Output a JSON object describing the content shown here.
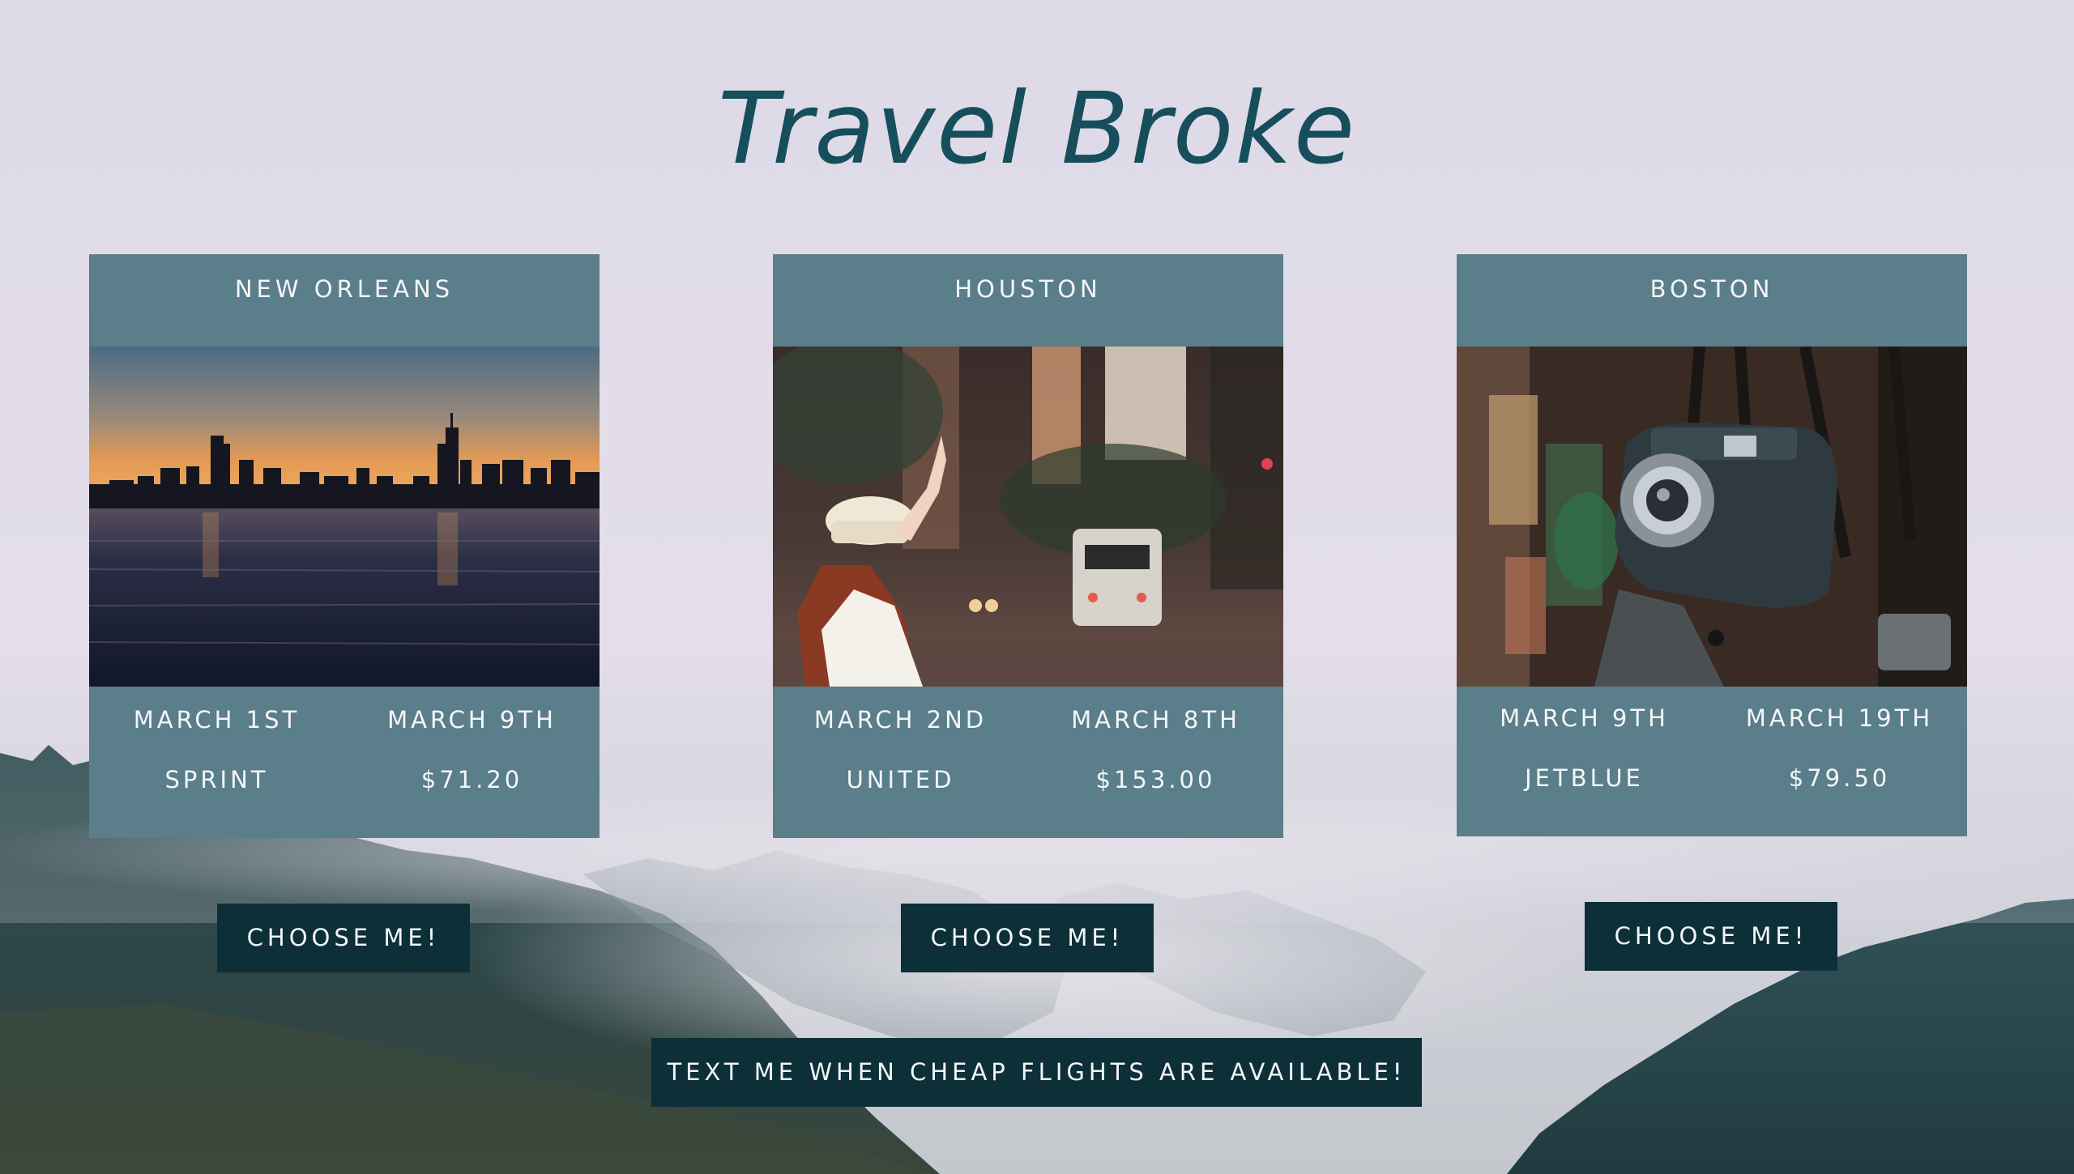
{
  "header": {
    "title": "Travel Broke"
  },
  "cards": [
    {
      "city": "NEW ORLEANS",
      "photo": "city-skyline-sunset-photo",
      "depart": "MARCH 1ST",
      "return": "MARCH 9TH",
      "airline": "SPRINT",
      "price": "$71.20",
      "button_label": "CHOOSE ME!"
    },
    {
      "city": "HOUSTON",
      "photo": "woman-in-city-street-photo",
      "depart": "MARCH 2ND",
      "return": "MARCH 8TH",
      "airline": "UNITED",
      "price": "$153.00",
      "button_label": "CHOOSE ME!"
    },
    {
      "city": "BOSTON",
      "photo": "vintage-cameras-photo",
      "depart": "MARCH 9TH",
      "return": "MARCH 19TH",
      "airline": "JETBLUE",
      "price": "$79.50",
      "button_label": "CHOOSE ME!"
    }
  ],
  "footer": {
    "notify_label": "TEXT ME WHEN CHEAP FLIGHTS ARE AVAILABLE!"
  },
  "colors": {
    "title": "#164e5c",
    "card": "#5a7e8a",
    "button": "#0d2f38",
    "text_light": "#f4f6f7"
  }
}
